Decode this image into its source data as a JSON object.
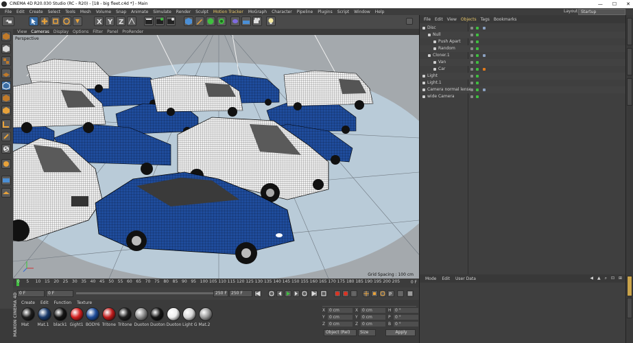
{
  "window": {
    "title": "CINEMA 4D R20.030 Studio (RC - R20) - [18 - big fleet.c4d *] - Main",
    "minimize": "—",
    "maximize": "☐",
    "close": "✕"
  },
  "menubar": {
    "items": [
      "File",
      "Edit",
      "Create",
      "Select",
      "Tools",
      "Mesh",
      "Volume",
      "Snap",
      "Animate",
      "Simulate",
      "Render",
      "Sculpt",
      "Motion Tracker",
      "MoGraph",
      "Character",
      "Pipeline",
      "Plugins",
      "Script",
      "Window",
      "Help"
    ],
    "highlighted": "Motion Tracker",
    "layout_label": "Layout:",
    "layout_value": "Startup"
  },
  "viewport": {
    "menu": [
      "View",
      "Cameras",
      "Display",
      "Options",
      "Filter",
      "Panel",
      "ProRender"
    ],
    "label": "Perspective",
    "grid_spacing": "Grid Spacing : 100 cm"
  },
  "timeline": {
    "ticks": [
      "0",
      "5",
      "10",
      "15",
      "20",
      "25",
      "30",
      "35",
      "40",
      "45",
      "50",
      "55",
      "60",
      "65",
      "70",
      "75",
      "80",
      "85",
      "90",
      "95",
      "100",
      "105",
      "110",
      "115",
      "120",
      "125",
      "130",
      "135",
      "140",
      "145",
      "150",
      "155",
      "160",
      "165",
      "170",
      "175",
      "180",
      "185",
      "190",
      "195",
      "200",
      "205"
    ],
    "current_frame": "0 F"
  },
  "transport": {
    "start_frame": "0 F",
    "preview_start": "0 F",
    "preview_end": "250 F",
    "end_frame": "250 F"
  },
  "materials": {
    "tabs": [
      "Create",
      "Edit",
      "Function",
      "Texture"
    ],
    "items": [
      {
        "name": "Mat",
        "color": "#1f1f1f"
      },
      {
        "name": "Mat.1",
        "color": "#1a3a6a"
      },
      {
        "name": "black1",
        "color": "#151515"
      },
      {
        "name": "Gight1",
        "color": "#d42020"
      },
      {
        "name": "BODY6",
        "color": "#1e4c9a"
      },
      {
        "name": "Tritone",
        "color": "#c01c1c"
      },
      {
        "name": "Tritone",
        "color": "#202020"
      },
      {
        "name": "Duoton",
        "color": "#8c8c8c"
      },
      {
        "name": "Duoton",
        "color": "#161616"
      },
      {
        "name": "Duoton",
        "color": "#eeeeee"
      },
      {
        "name": "Light Gr",
        "color": "#d8d8d8"
      },
      {
        "name": "Mat.2",
        "color": "#9a9a9a"
      }
    ]
  },
  "coords": {
    "headers": [
      "—",
      "—",
      "—"
    ],
    "rows": [
      {
        "a": "X",
        "av": "0 cm",
        "b": "X",
        "bv": "0 cm",
        "c": "H",
        "cv": "0 °"
      },
      {
        "a": "Y",
        "av": "0 cm",
        "b": "Y",
        "bv": "0 cm",
        "c": "P",
        "cv": "0 °"
      },
      {
        "a": "Z",
        "av": "0 cm",
        "b": "Z",
        "bv": "0 cm",
        "c": "B",
        "cv": "0 °"
      }
    ],
    "mode": "Object (Rel)",
    "size_mode": "Size",
    "apply": "Apply"
  },
  "objects": {
    "tabs": [
      "File",
      "Edit",
      "View",
      "Objects",
      "Tags",
      "Bookmarks"
    ],
    "active_tab": "Objects",
    "rows": [
      {
        "name": "Disc",
        "indent": 0
      },
      {
        "name": "Null",
        "indent": 1
      },
      {
        "name": "Push Apart",
        "indent": 2
      },
      {
        "name": "Random",
        "indent": 2
      },
      {
        "name": "Cloner.1",
        "indent": 1
      },
      {
        "name": "Van",
        "indent": 2
      },
      {
        "name": "Car",
        "indent": 2
      },
      {
        "name": "Light",
        "indent": 0
      },
      {
        "name": "Light.1",
        "indent": 0
      },
      {
        "name": "Camera normal lense",
        "indent": 0
      },
      {
        "name": "wide Camera",
        "indent": 0
      }
    ]
  },
  "attributes": {
    "tabs": [
      "Mode",
      "Edit",
      "User Data"
    ]
  },
  "branding": {
    "logo_text": "MAXON CINEMA 4D"
  },
  "colors": {
    "accent": "#e8c76a",
    "active_tool": "#3a6ea5",
    "car_blue": "#1f4c9c",
    "tag_green": "#3fbf3f",
    "tag_orange": "#e07a1c"
  }
}
